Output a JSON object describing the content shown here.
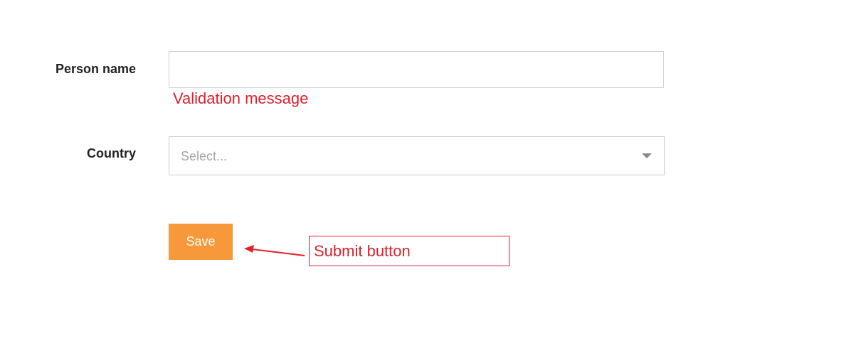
{
  "form": {
    "name_label": "Person name",
    "name_value": "",
    "validation_message": "Validation message",
    "country_label": "Country",
    "country_placeholder": "Select...",
    "save_label": "Save"
  },
  "annotation": {
    "text": "Submit button",
    "color": "#e0202b"
  },
  "colors": {
    "save_button": "#f7993a",
    "validation": "#e0202b"
  },
  "icons": {
    "select_caret": "chevron-down-icon",
    "annotation_arrow": "arrow-left-icon"
  }
}
